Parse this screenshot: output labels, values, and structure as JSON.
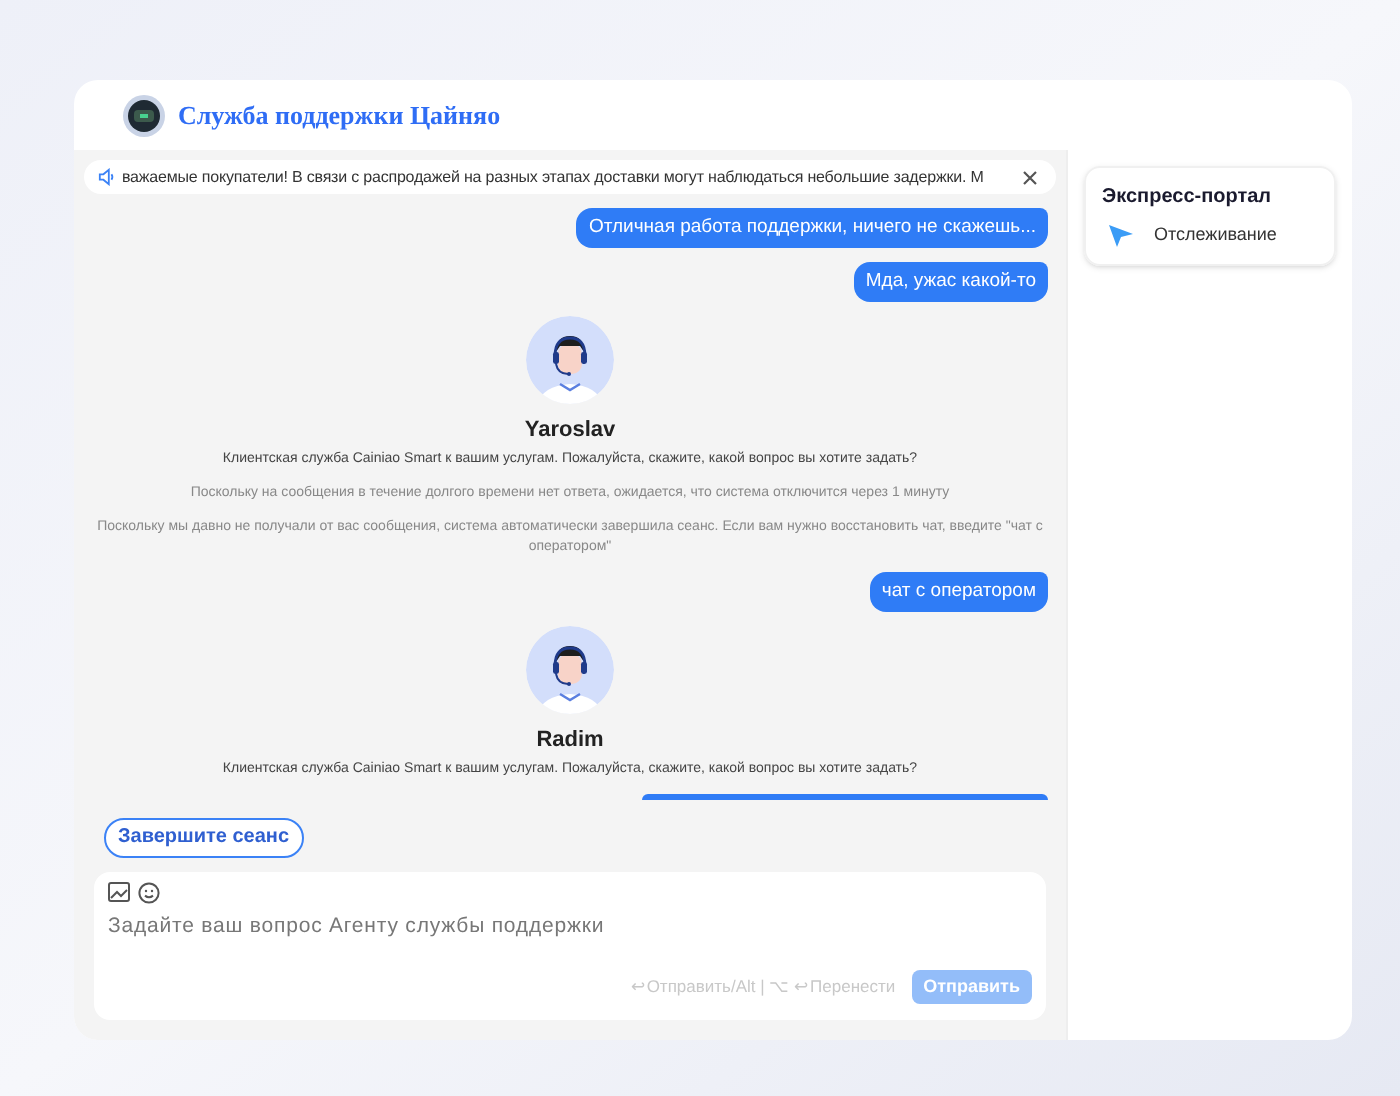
{
  "header": {
    "title": "Служба поддержки Цайняо"
  },
  "notice": {
    "text": "важаемые покупатели! В связи с распродажей на разных этапах доставки могут наблюдаться небольшие задержки. М"
  },
  "messages": [
    {
      "kind": "user",
      "text": "Отличная работа поддержки, ничего не скажешь..."
    },
    {
      "kind": "user",
      "text": "Мда, ужас какой-то"
    },
    {
      "kind": "agent",
      "name": "Yaroslav",
      "text": "Клиентская служба Cainiao Smart к вашим услугам. Пожалуйста, скажите, какой вопрос вы хотите задать?"
    },
    {
      "kind": "system",
      "text": "Поскольку на сообщения в течение долгого времени нет ответа, ожидается, что система отключится через 1 минуту"
    },
    {
      "kind": "system",
      "text": "Поскольку мы давно не получали от вас сообщения, система автоматически завершила сеанс. Если вам нужно восстановить чат, введите \"чат с оператором\""
    },
    {
      "kind": "user",
      "text": "чат с оператором"
    },
    {
      "kind": "agent",
      "name": "Radim",
      "text": "Клиентская служба Cainiao Smart к вашим услугам. Пожалуйста, скажите, какой вопрос вы хотите задать?"
    }
  ],
  "end_session_button": "Завершите сеанс",
  "composer": {
    "placeholder": "Задайте ваш вопрос Агенту службы поддержки",
    "hint": "↩Отправить/Alt | ⌥ ↩Перенести",
    "send_button": {
      "label": "Отправить",
      "disabled": true
    }
  },
  "sidebar": {
    "title": "Экспресс-портал",
    "items": [
      {
        "label": "Отслеживание"
      }
    ]
  }
}
